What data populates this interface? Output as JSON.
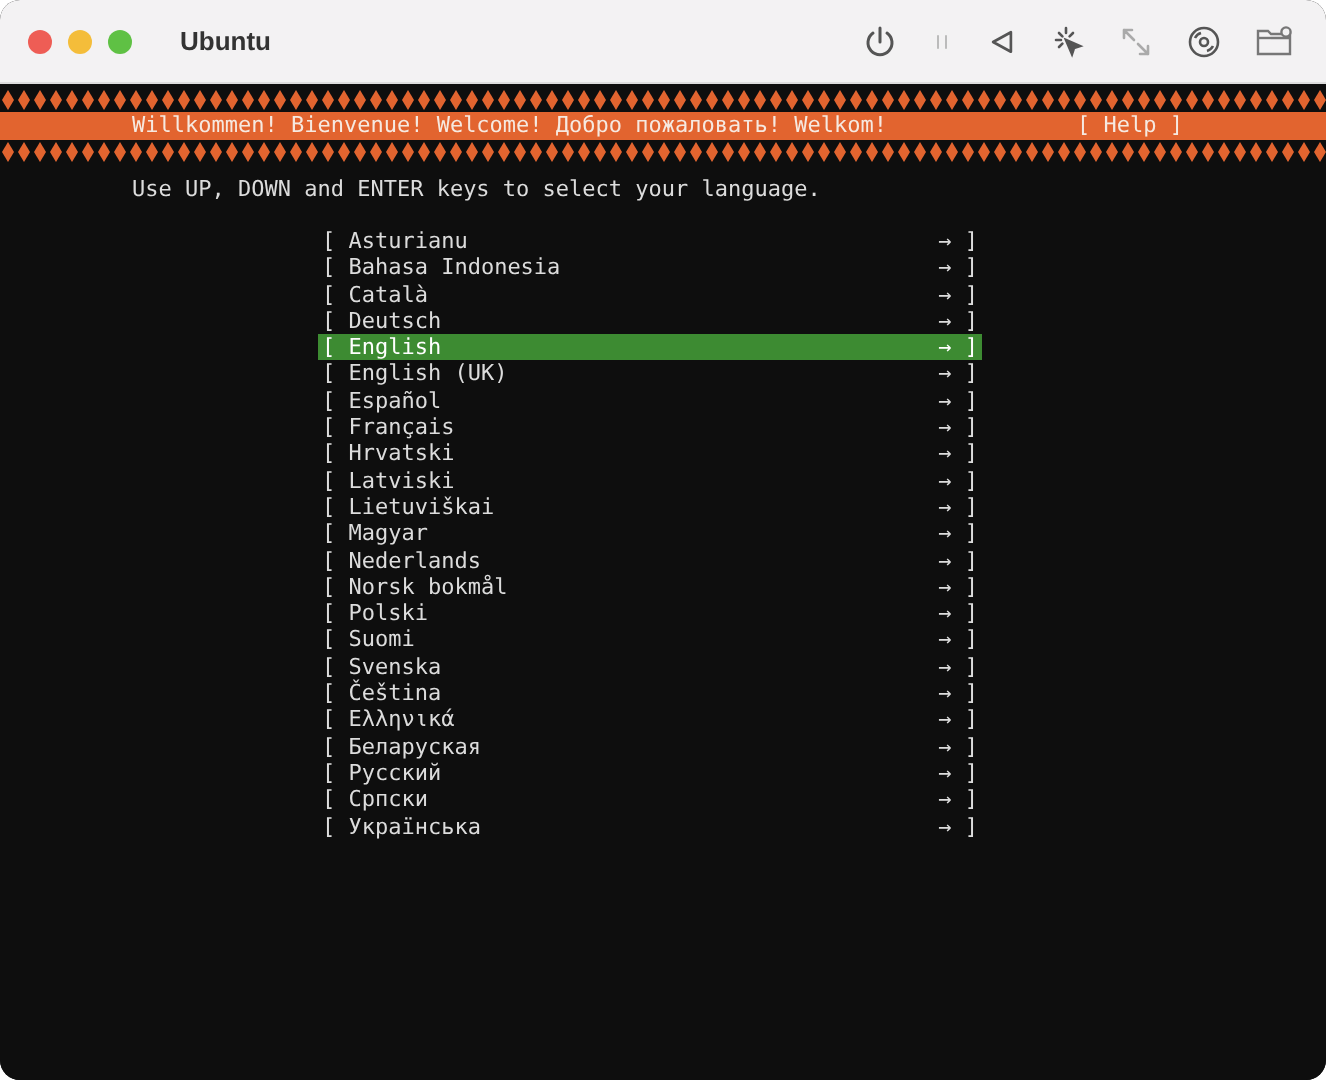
{
  "window": {
    "title": "Ubuntu"
  },
  "header": {
    "greeting": "Willkommen! Bienvenue! Welcome! Добро пожаловать! Welkom!",
    "help": "[ Help ]"
  },
  "instruction": "Use UP, DOWN and ENTER keys to select your language.",
  "languages": [
    {
      "left": "[",
      "label": "Asturianu",
      "arrow": "→",
      "right": "]",
      "selected": false
    },
    {
      "left": "[",
      "label": "Bahasa Indonesia",
      "arrow": "→",
      "right": "]",
      "selected": false
    },
    {
      "left": "[",
      "label": "Català",
      "arrow": "→",
      "right": "]",
      "selected": false
    },
    {
      "left": "[",
      "label": "Deutsch",
      "arrow": "→",
      "right": "]",
      "selected": false
    },
    {
      "left": "[",
      "label": "English",
      "arrow": "→",
      "right": "]",
      "selected": true
    },
    {
      "left": "[",
      "label": "English (UK)",
      "arrow": "→",
      "right": "]",
      "selected": false
    },
    {
      "left": "[",
      "label": "Español",
      "arrow": "→",
      "right": "]",
      "selected": false
    },
    {
      "left": "[",
      "label": "Français",
      "arrow": "→",
      "right": "]",
      "selected": false
    },
    {
      "left": "[",
      "label": "Hrvatski",
      "arrow": "→",
      "right": "]",
      "selected": false
    },
    {
      "left": "[",
      "label": "Latviski",
      "arrow": "→",
      "right": "]",
      "selected": false
    },
    {
      "left": "[",
      "label": "Lietuviškai",
      "arrow": "→",
      "right": "]",
      "selected": false
    },
    {
      "left": "[",
      "label": "Magyar",
      "arrow": "→",
      "right": "]",
      "selected": false
    },
    {
      "left": "[",
      "label": "Nederlands",
      "arrow": "→",
      "right": "]",
      "selected": false
    },
    {
      "left": "[",
      "label": "Norsk bokmål",
      "arrow": "→",
      "right": "]",
      "selected": false
    },
    {
      "left": "[",
      "label": "Polski",
      "arrow": "→",
      "right": "]",
      "selected": false
    },
    {
      "left": "[",
      "label": "Suomi",
      "arrow": "→",
      "right": "]",
      "selected": false
    },
    {
      "left": "[",
      "label": "Svenska",
      "arrow": "→",
      "right": "]",
      "selected": false
    },
    {
      "left": "[",
      "label": "Čeština",
      "arrow": "→",
      "right": "]",
      "selected": false
    },
    {
      "left": "[",
      "label": "Ελληνικά",
      "arrow": "→",
      "right": "]",
      "selected": false
    },
    {
      "left": "[",
      "label": "Беларуская",
      "arrow": "→",
      "right": "]",
      "selected": false
    },
    {
      "left": "[",
      "label": "Русский",
      "arrow": "→",
      "right": "]",
      "selected": false
    },
    {
      "left": "[",
      "label": "Српски",
      "arrow": "→",
      "right": "]",
      "selected": false
    },
    {
      "left": "[",
      "label": "Українська",
      "arrow": "→",
      "right": "]",
      "selected": false
    }
  ]
}
